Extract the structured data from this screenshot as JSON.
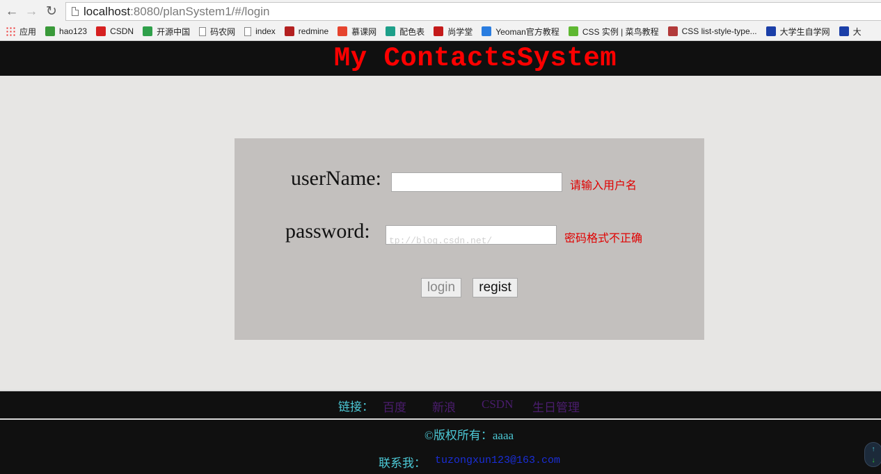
{
  "browser": {
    "url_host": "localhost",
    "url_rest": ":8080/planSystem1/#/login",
    "nav": {
      "back": "←",
      "forward": "→",
      "reload": "↻"
    },
    "bookmarks": [
      {
        "label": "应用",
        "icon": "apps-grid-icon",
        "color": "#e04040"
      },
      {
        "label": "hao123",
        "icon": "hao123-icon",
        "color": "#3a9a3a"
      },
      {
        "label": "CSDN",
        "icon": "csdn-icon",
        "color": "#d62020"
      },
      {
        "label": "开源中国",
        "icon": "oschina-icon",
        "color": "#2fa04a"
      },
      {
        "label": "码农网",
        "icon": "file-icon",
        "color": "#888888"
      },
      {
        "label": "index",
        "icon": "file-icon",
        "color": "#888888"
      },
      {
        "label": "redmine",
        "icon": "redmine-icon",
        "color": "#b32020"
      },
      {
        "label": "慕课网",
        "icon": "imooc-icon",
        "color": "#e6442e"
      },
      {
        "label": "配色表",
        "icon": "peise-icon",
        "color": "#1ea08a"
      },
      {
        "label": "尚学堂",
        "icon": "sxt-icon",
        "color": "#c41a1a"
      },
      {
        "label": "Yeoman官方教程",
        "icon": "yeoman-icon",
        "color": "#2a7de0"
      },
      {
        "label": "CSS 实例 | 菜鸟教程",
        "icon": "runoob-icon",
        "color": "#5fb832"
      },
      {
        "label": "CSS list-style-type...",
        "icon": "w3-icon",
        "color": "#b23a3a"
      },
      {
        "label": "大学生自学网",
        "icon": "zixue-icon",
        "color": "#1b3fa8"
      },
      {
        "label": "大",
        "icon": "zixue2-icon",
        "color": "#1b3fa8"
      }
    ]
  },
  "header": {
    "title": "My ContactsSystem"
  },
  "login": {
    "username_label": "userName:",
    "username_value": "",
    "username_error": "请输入用户名",
    "password_label": "password:",
    "password_value": "tp://blog.csdn.net/",
    "password_error": "密码格式不正确",
    "login_button": "login",
    "regist_button": "regist"
  },
  "links": {
    "label": "链接：",
    "items": [
      "百度",
      "新浪",
      "CSDN",
      "生日管理"
    ]
  },
  "footer": {
    "copyright": "©版权所有：aaaa",
    "contact_label": "联系我：",
    "contact_email": "tuzongxun123@163.com"
  },
  "colors": {
    "title": "#ff0000",
    "error": "#e00000",
    "footer_text": "#4cc9d6",
    "link": "#4b1d6e",
    "email": "#1a2ed8"
  }
}
